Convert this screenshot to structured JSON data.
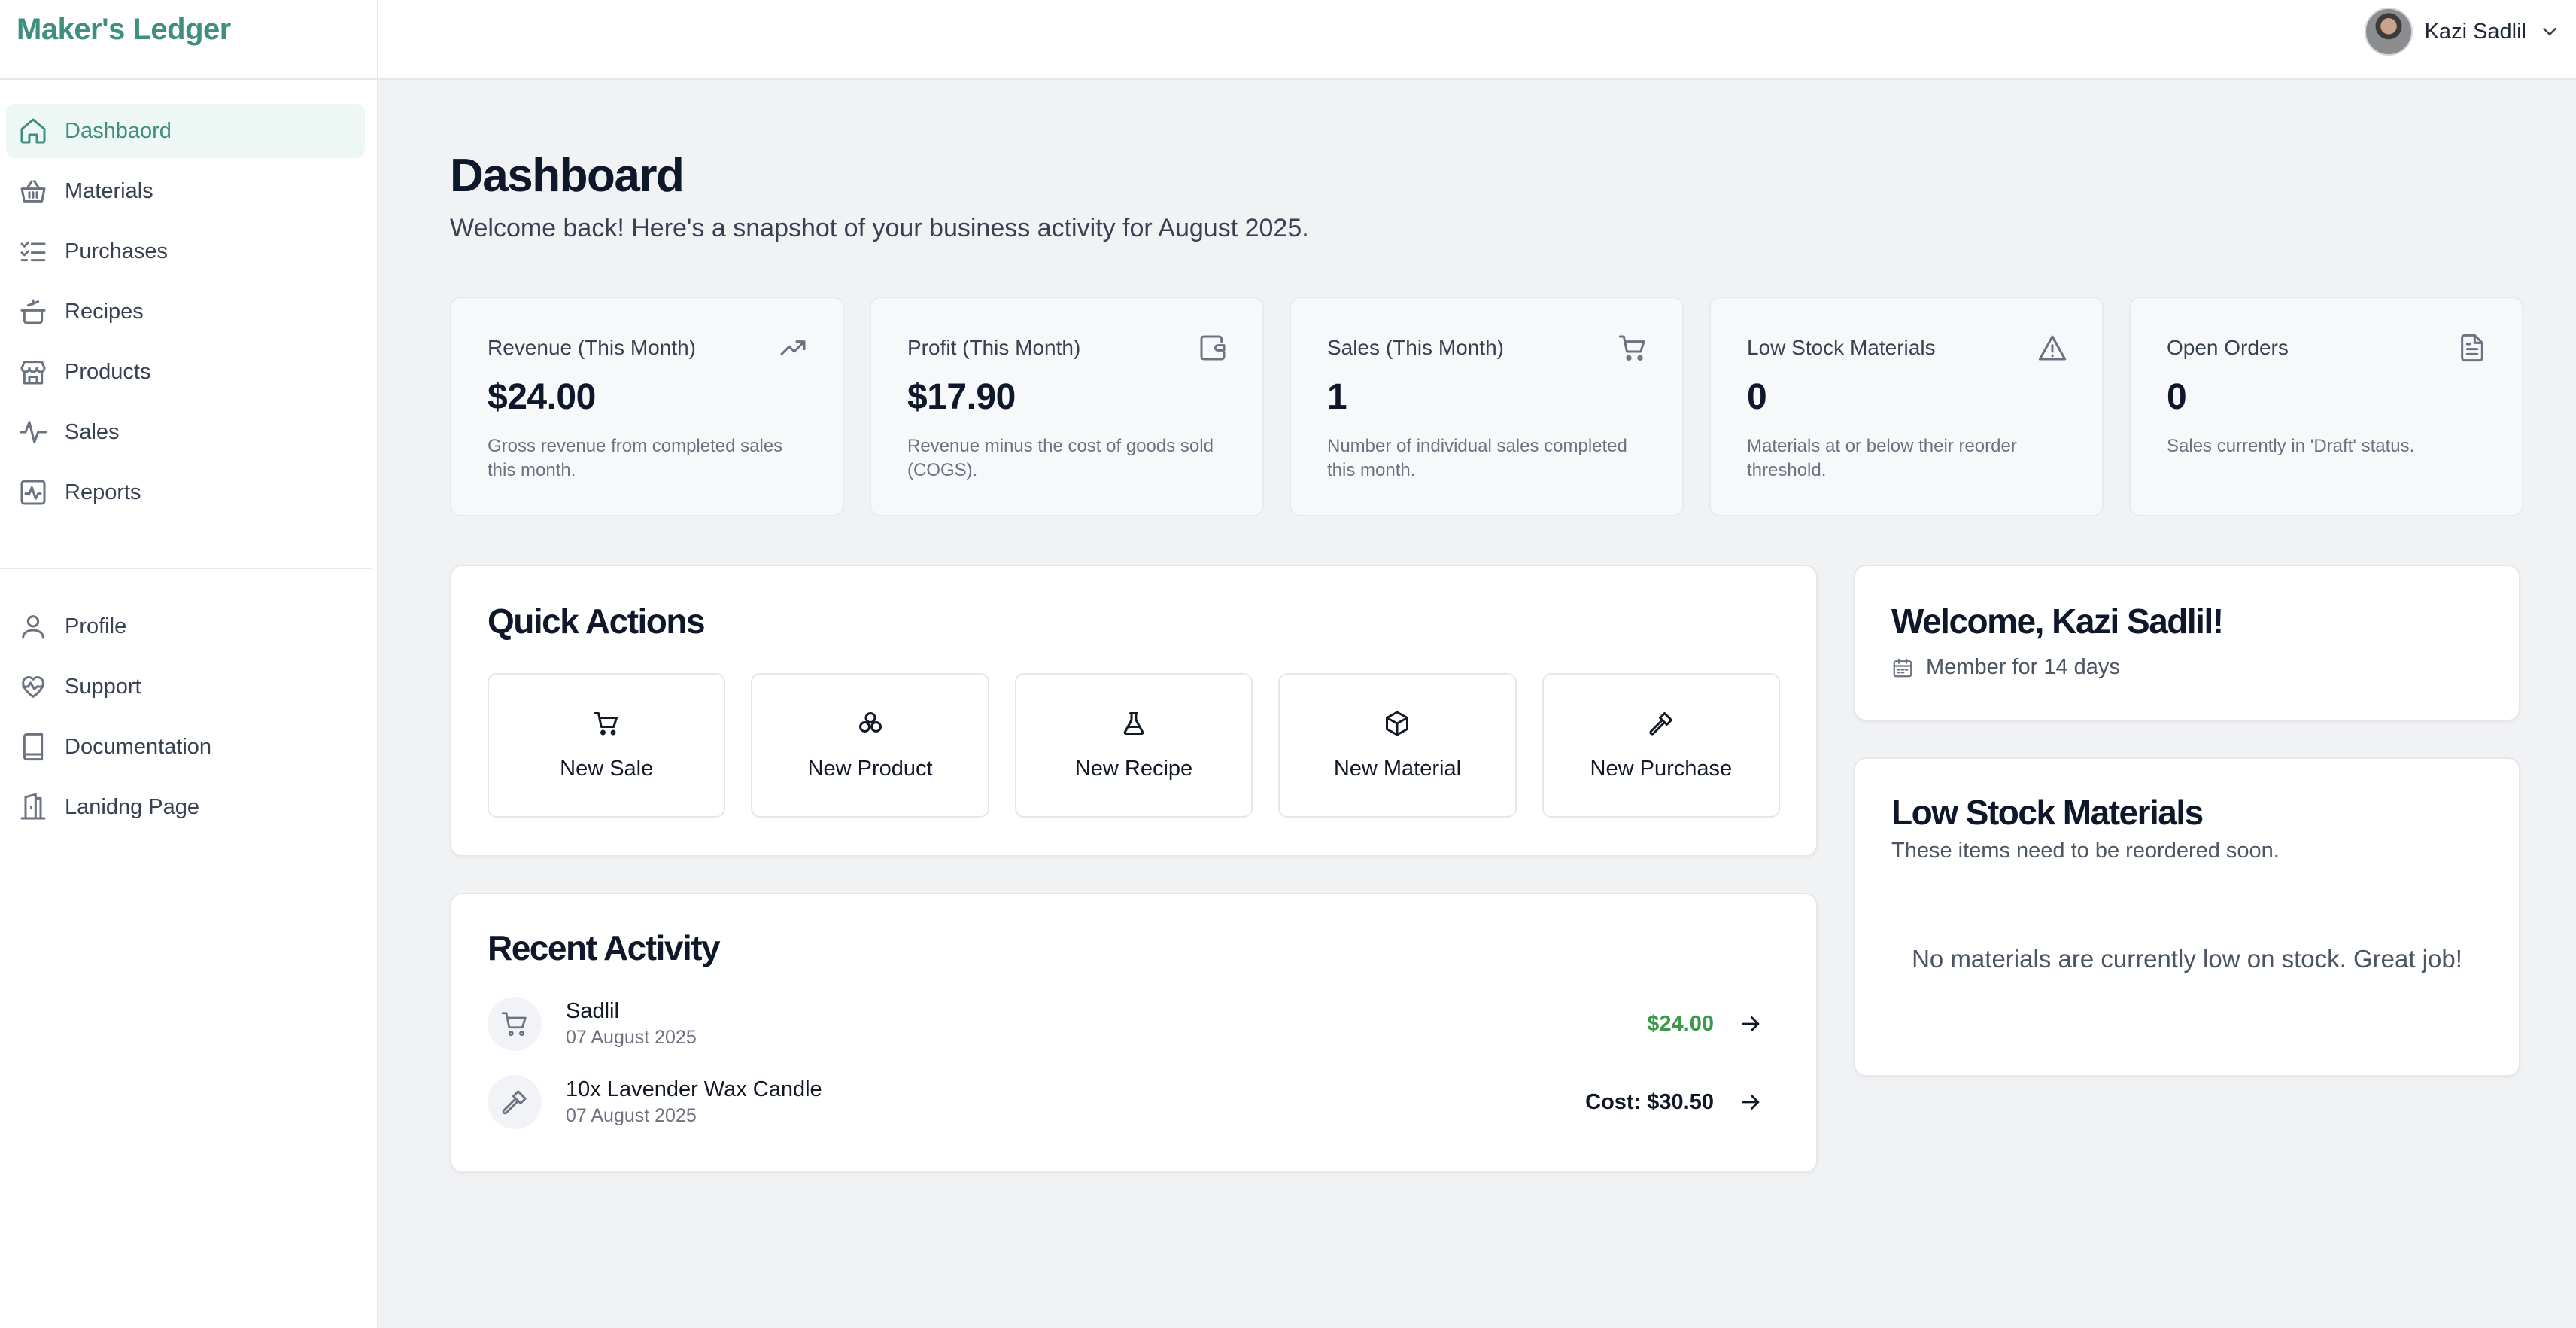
{
  "app": {
    "brand": "Maker's Ledger"
  },
  "sidebar": {
    "items": [
      {
        "label": "Dashbaord",
        "icon": "home-icon",
        "active": true
      },
      {
        "label": "Materials",
        "icon": "basket-icon"
      },
      {
        "label": "Purchases",
        "icon": "list-check-icon"
      },
      {
        "label": "Recipes",
        "icon": "cooking-pot-icon"
      },
      {
        "label": "Products",
        "icon": "store-icon"
      },
      {
        "label": "Sales",
        "icon": "activity-icon"
      },
      {
        "label": "Reports",
        "icon": "chart-pulse-icon"
      }
    ],
    "secondary": [
      {
        "label": "Profile",
        "icon": "user-icon"
      },
      {
        "label": "Support",
        "icon": "heart-pulse-icon"
      },
      {
        "label": "Documentation",
        "icon": "book-icon"
      },
      {
        "label": "Lanidng Page",
        "icon": "door-icon"
      }
    ]
  },
  "header": {
    "user_name": "Kazi Sadlil"
  },
  "page": {
    "title": "Dashboard",
    "subtitle": "Welcome back! Here's a snapshot of your business activity for August 2025."
  },
  "stats": [
    {
      "label": "Revenue (This Month)",
      "value": "$24.00",
      "desc": "Gross revenue from completed sales this month.",
      "icon": "trending-up-icon"
    },
    {
      "label": "Profit (This Month)",
      "value": "$17.90",
      "desc": "Revenue minus the cost of goods sold (COGS).",
      "icon": "wallet-icon"
    },
    {
      "label": "Sales (This Month)",
      "value": "1",
      "desc": "Number of individual sales completed this month.",
      "icon": "cart-icon"
    },
    {
      "label": "Low Stock Materials",
      "value": "0",
      "desc": "Materials at or below their reorder threshold.",
      "icon": "alert-triangle-icon"
    },
    {
      "label": "Open Orders",
      "value": "0",
      "desc": "Sales currently in 'Draft' status.",
      "icon": "document-icon"
    }
  ],
  "quick_actions": {
    "title": "Quick Actions",
    "items": [
      {
        "label": "New Sale",
        "icon": "cart-icon"
      },
      {
        "label": "New Product",
        "icon": "cubes-icon"
      },
      {
        "label": "New Recipe",
        "icon": "flask-icon"
      },
      {
        "label": "New Material",
        "icon": "box-icon"
      },
      {
        "label": "New Purchase",
        "icon": "hammer-icon"
      }
    ]
  },
  "recent_activity": {
    "title": "Recent Activity",
    "items": [
      {
        "title": "Sadlil",
        "date": "07 August 2025",
        "amount": "$24.00",
        "amount_color": "#3a9a4a",
        "icon": "cart-icon"
      },
      {
        "title": "10x Lavender Wax Candle",
        "date": "07 August 2025",
        "amount": "Cost: $30.50",
        "amount_color": "#111827",
        "icon": "hammer-icon"
      }
    ]
  },
  "welcome": {
    "title": "Welcome, Kazi Sadlil!",
    "member_text": "Member for 14 days",
    "icon": "calendar-icon"
  },
  "low_stock": {
    "title": "Low Stock Materials",
    "subtitle": "These items need to be reordered soon.",
    "empty_text": "No materials are currently low on stock. Great job!"
  },
  "colors": {
    "brand": "#3f8f7f",
    "active_bg": "#edf7f4",
    "positive": "#3a9a4a"
  }
}
